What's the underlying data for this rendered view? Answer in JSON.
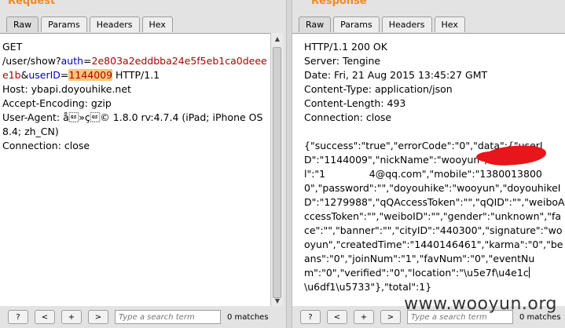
{
  "request": {
    "title": "Request",
    "tabs": [
      "Raw",
      "Params",
      "Headers",
      "Hex"
    ],
    "line1": "GET",
    "path_prefix": "/user/show?",
    "p1_name": "auth",
    "eq1": "=",
    "p1_value": "2e803a2eddbba24e5f5eb1ca0deeee1b",
    "amp": "&",
    "p2_name": "userID",
    "eq2": "=",
    "p2_value": "1144009",
    "proto": " HTTP/1.1",
    "host": "Host: ybapi.doyouhike.net",
    "accept_encoding": "Accept-Encoding: gzip",
    "user_agent": "User-Agent: å\u001d»ç\u001d© 1.8.0 rv:4.7.4 (iPad; iPhone OS 8.4; zh_CN)",
    "connection": "Connection: close",
    "footer": {
      "help": "?",
      "prev": "<",
      "add": "+",
      "next": ">",
      "search_placeholder": "Type a search term",
      "matches": "0 matches"
    }
  },
  "response": {
    "title": "Response",
    "tabs": [
      "Raw",
      "Params",
      "Headers",
      "Hex"
    ],
    "status": "HTTP/1.1 200 OK",
    "server": "Server: Tengine",
    "date": "Date: Fri, 21 Aug 2015 13:45:27 GMT",
    "content_type": "Content-Type: application/json",
    "content_length": "Content-Length: 493",
    "connection": "Connection: close",
    "body": "{\"success\":\"true\",\"errorCode\":\"0\",\"data\":{\"userID\":\"1144009\",\"nickName\":\"wooyun\",\"email\":\"1              4@qq.com\",\"mobile\":\"13800138000\",\"password\":\"\",\"doyouhike\":\"wooyun\",\"doyouhikeID\":\"1279988\",\"qQAccessToken\":\"\",\"qQID\":\"\",\"weiboAccessToken\":\"\",\"weiboID\":\"\",\"gender\":\"unknown\",\"face\":\"\",\"banner\":\"\",\"cityID\":\"440300\",\"signature\":\"wooyun\",\"createdTime\":\"1440146461\",\"karma\":\"0\",\"beans\":\"0\",\"joinNum\":\"1\",\"favNum\":\"0\",\"eventNum\":\"0\",\"verified\":\"0\",\"location\":\"\\u5e7f\\u4e1c",
    "body_tail": "\\u6df1\\u5733\"},\"total\":1}",
    "footer": {
      "help": "?",
      "prev": "<",
      "add": "+",
      "next": ">",
      "search_placeholder": "Type a search term",
      "matches": "0 matches"
    }
  },
  "watermark": "www.wooyun.org",
  "colors": {
    "title": "#f08a24",
    "param_name": "#0000cc",
    "param_value": "#b00000",
    "highlight": "#f7c67a",
    "redaction": "#e8151b"
  }
}
